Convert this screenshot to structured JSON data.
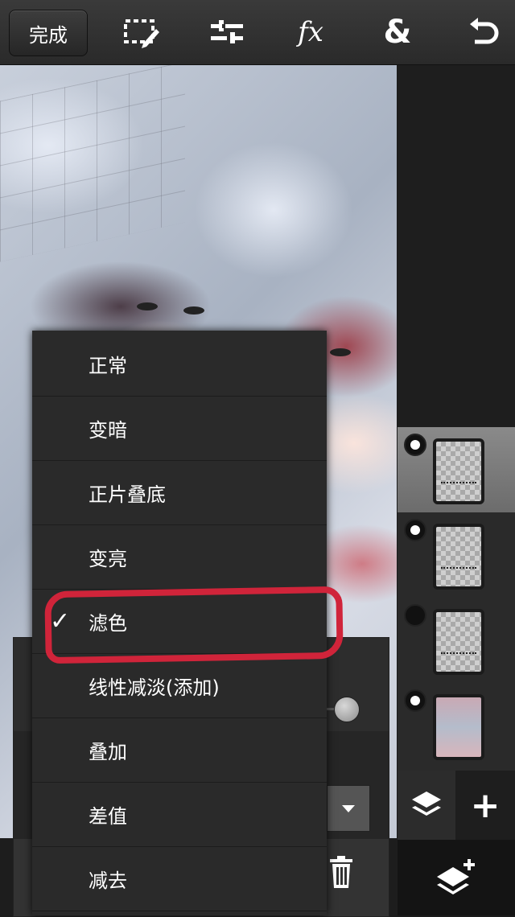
{
  "toolbar": {
    "done_label": "完成",
    "tools": [
      "selection-edit-icon",
      "adjust-sliders-icon",
      "fx-icon",
      "ampersand-icon",
      "undo-icon"
    ],
    "fx_label": "fx",
    "amp_label": "&"
  },
  "blend_menu": {
    "items": [
      {
        "label": "正常",
        "selected": false
      },
      {
        "label": "变暗",
        "selected": false
      },
      {
        "label": "正片叠底",
        "selected": false
      },
      {
        "label": "变亮",
        "selected": false
      },
      {
        "label": "滤色",
        "selected": true
      },
      {
        "label": "线性减淡(添加)",
        "selected": false
      },
      {
        "label": "叠加",
        "selected": false
      },
      {
        "label": "差值",
        "selected": false
      },
      {
        "label": "减去",
        "selected": false
      }
    ],
    "check_glyph": "✓",
    "annotation_color": "#d0243a"
  },
  "layers": {
    "items": [
      {
        "visible": true,
        "active": true,
        "thumb": "transparent-with-text"
      },
      {
        "visible": true,
        "active": false,
        "thumb": "transparent-with-text"
      },
      {
        "visible": false,
        "active": false,
        "thumb": "transparent-with-text"
      },
      {
        "visible": true,
        "active": false,
        "thumb": "photo"
      }
    ],
    "add_label": "+"
  },
  "colors": {
    "toolbar_bg": "#2a2a2a",
    "menu_bg": "#2a2a2a",
    "highlight_red": "#d0243a"
  }
}
